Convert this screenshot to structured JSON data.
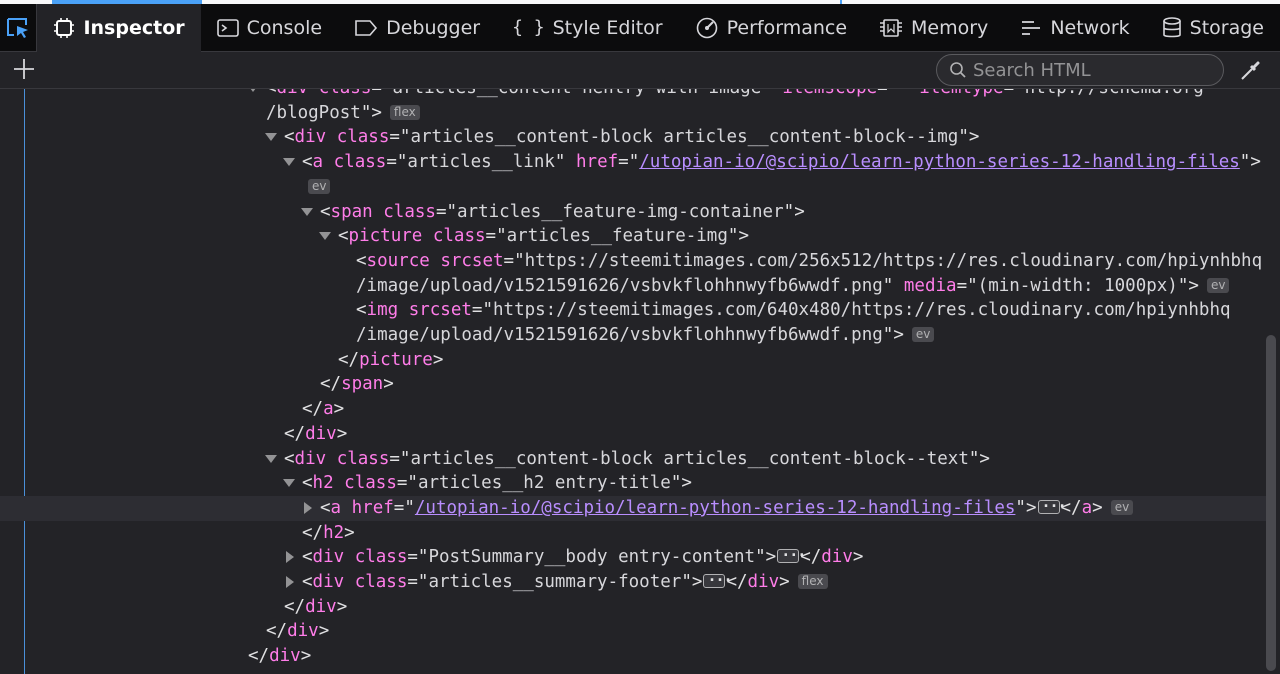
{
  "toolbar": {
    "tabs": [
      {
        "label": "Inspector",
        "icon": "inspector-icon"
      },
      {
        "label": "Console",
        "icon": "console-icon"
      },
      {
        "label": "Debugger",
        "icon": "debugger-icon"
      },
      {
        "label": "Style Editor",
        "icon": "style-editor-icon"
      },
      {
        "label": "Performance",
        "icon": "performance-icon"
      },
      {
        "label": "Memory",
        "icon": "memory-icon"
      },
      {
        "label": "Network",
        "icon": "network-icon"
      },
      {
        "label": "Storage",
        "icon": "storage-icon"
      }
    ],
    "active_tab": "Inspector"
  },
  "search": {
    "placeholder": "Search HTML"
  },
  "colors": {
    "tag": "#ff7de9",
    "link": "#b98eff",
    "value": "#d7d7db",
    "background": "#232327",
    "guide": "#4a90d9"
  },
  "markup": {
    "lines": [
      {
        "indent": 13,
        "twisty": "open",
        "text": "<div class=\"articles__content hentry with-image\" itemscope=\"\" itemtype=\"http://schema.org"
      },
      {
        "text": "/blogPost\">",
        "badge": "flex"
      },
      {
        "twisty": "open",
        "tag_open": "div",
        "attrs": [
          {
            "name": "class",
            "value": "articles__content-block articles__content-block--img"
          }
        ],
        "close": ">"
      },
      {
        "twisty": "open",
        "tag_open": "a",
        "attrs": [
          {
            "name": "class",
            "value": "articles__link"
          },
          {
            "name": "href",
            "value": "/utopian-io/@scipio/learn-python-series-12-handling-files",
            "link": true
          }
        ],
        "close": ">"
      },
      {
        "badge": "ev"
      },
      {
        "twisty": "open",
        "tag_open": "span",
        "attrs": [
          {
            "name": "class",
            "value": "articles__feature-img-container"
          }
        ],
        "close": ">"
      },
      {
        "twisty": "open",
        "tag_open": "picture",
        "attrs": [
          {
            "name": "class",
            "value": "articles__feature-img"
          }
        ],
        "close": ">"
      },
      {
        "tag_open": "source",
        "attrs": [
          {
            "name": "srcset",
            "value": "https://steemitimages.com/256x512/https://res.cloudinary.com/hpiynhbhq"
          }
        ]
      },
      {
        "cont": "/image/upload/v1521591626/vsbvkflohhnwyfb6wwdf.png\"",
        "attrs": [
          {
            "name": "media",
            "value": "(min-width: 1000px)"
          }
        ],
        "close": ">",
        "badge": "ev"
      },
      {
        "tag_open": "img",
        "attrs": [
          {
            "name": "srcset",
            "value": "https://steemitimages.com/640x480/https://res.cloudinary.com/hpiynhbhq"
          }
        ]
      },
      {
        "cont": "/image/upload/v1521591626/vsbvkflohhnwyfb6wwdf.png\"",
        "close": ">",
        "badge": "ev"
      },
      {
        "tag_close": "picture"
      },
      {
        "tag_close": "span"
      },
      {
        "tag_close": "a"
      },
      {
        "tag_close": "div"
      },
      {
        "twisty": "open",
        "tag_open": "div",
        "attrs": [
          {
            "name": "class",
            "value": "articles__content-block articles__content-block--text"
          }
        ],
        "close": ">"
      },
      {
        "twisty": "open",
        "tag_open": "h2",
        "attrs": [
          {
            "name": "class",
            "value": "articles__h2 entry-title"
          }
        ],
        "close": ">"
      },
      {
        "twisty": "closed",
        "selected": true,
        "tag_open": "a",
        "attrs": [
          {
            "name": "href",
            "value": "/utopian-io/@scipio/learn-python-series-12-handling-files",
            "link": true
          }
        ],
        "close": ">",
        "collapsed_tag": "a",
        "badge": "ev"
      },
      {
        "tag_close": "h2"
      },
      {
        "twisty": "closed",
        "tag_open": "div",
        "attrs": [
          {
            "name": "class",
            "value": "PostSummary__body entry-content"
          }
        ],
        "close": ">",
        "collapsed_tag": "div"
      },
      {
        "twisty": "closed",
        "tag_open": "div",
        "attrs": [
          {
            "name": "class",
            "value": "articles__summary-footer"
          }
        ],
        "close": ">",
        "collapsed_tag": "div",
        "badge": "flex"
      },
      {
        "tag_close": "div"
      },
      {
        "tag_close": "div"
      },
      {
        "tag_close": "div"
      }
    ]
  }
}
